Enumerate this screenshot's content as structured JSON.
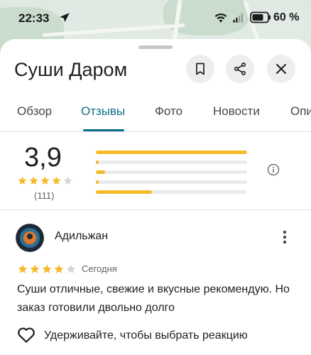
{
  "status_bar": {
    "time": "22:33",
    "battery_percent": "60 %",
    "icons": [
      "navigation-arrow-icon",
      "wifi-icon",
      "signal-icon",
      "battery-icon"
    ]
  },
  "place": {
    "name": "Суши Даром",
    "actions": [
      "bookmark-icon",
      "share-icon",
      "close-icon"
    ]
  },
  "tabs": [
    {
      "label": "Обзор",
      "active": false
    },
    {
      "label": "Отзывы",
      "active": true
    },
    {
      "label": "Фото",
      "active": false
    },
    {
      "label": "Новости",
      "active": false
    },
    {
      "label": "Опи",
      "active": false
    }
  ],
  "rating_summary": {
    "average": "3,9",
    "stars_filled": 4,
    "count": "(111)",
    "distribution": [
      {
        "stars": 5,
        "fraction": 1.0
      },
      {
        "stars": 4,
        "fraction": 0.02
      },
      {
        "stars": 3,
        "fraction": 0.06
      },
      {
        "stars": 2,
        "fraction": 0.02
      },
      {
        "stars": 1,
        "fraction": 0.37
      }
    ]
  },
  "review": {
    "author": "Адильжан",
    "rating": 4,
    "date": "Сегодня",
    "text": "Суши отличные, свежие и вкусные рекомендую. Но заказ готовили двольно долго",
    "reaction_label": "Удерживайте, чтобы выбрать реакцию"
  },
  "colors": {
    "accent": "#0b6e85",
    "star": "#f6bb2c",
    "star_empty": "#d6d6d6"
  }
}
